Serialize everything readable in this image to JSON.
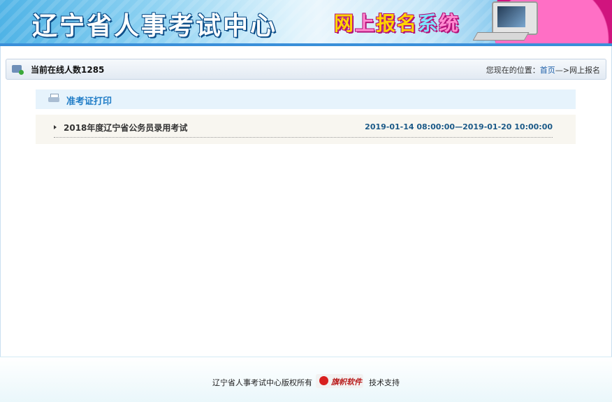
{
  "header": {
    "title": "辽宁省人事考试中心",
    "system_chars": [
      "网",
      "上",
      "报",
      "名",
      "系",
      "统"
    ]
  },
  "status_bar": {
    "online_text": "当前在线人数1285",
    "location_prefix": "您现在的位置：",
    "location_home": "首页",
    "location_sep": "—>",
    "location_current": "网上报名"
  },
  "section": {
    "title": "准考证打印"
  },
  "exams": [
    {
      "name": "2018年度辽宁省公务员录用考试",
      "period": "2019-01-14 08:00:00—2019-01-20 10:00:00"
    }
  ],
  "footer": {
    "copyright": "辽宁省人事考试中心版权所有",
    "logo_text": "旗帜软件",
    "support": "技术支持"
  },
  "colors": {
    "accent": "#1f7cc6",
    "header_blue": "#3a8fd9",
    "date_color": "#1c5a88"
  }
}
